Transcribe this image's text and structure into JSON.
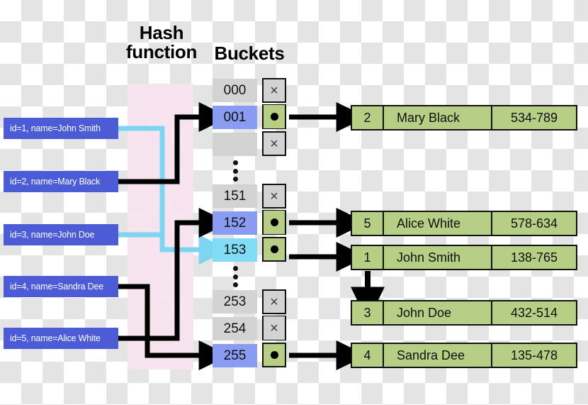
{
  "headings": {
    "hash_function": "Hash\nfunction",
    "buckets": "Buckets"
  },
  "colors": {
    "input_box": "#4c5cd6",
    "bucket_highlight_blue": "#8a9bf2",
    "bucket_highlight_cyan": "#7fdcf4",
    "bucket_default": "#d3d3d3",
    "record_green": "#b6cf85",
    "hash_band_pink": "#f7e3ee",
    "wire_black": "#000000",
    "wire_cyan": "#7fd4f2"
  },
  "inputs": [
    {
      "label": "id=1, name=John Smith",
      "id": "1",
      "name": "John Smith"
    },
    {
      "label": "id=2, name=Mary Black",
      "id": "2",
      "name": "Mary Black"
    },
    {
      "label": "id=3, name=John Doe",
      "id": "3",
      "name": "John Doe"
    },
    {
      "label": "id=4, name=Sandra Dee",
      "id": "4",
      "name": "Sandra Dee"
    },
    {
      "label": "id=5, name=Alice White",
      "id": "5",
      "name": "Alice White"
    }
  ],
  "buckets": [
    {
      "index": "000",
      "flag": "×",
      "occupied": false,
      "highlight": "none"
    },
    {
      "index": "001",
      "flag": "dot",
      "occupied": true,
      "highlight": "blue"
    },
    {
      "index": "",
      "flag": "×",
      "occupied": false,
      "highlight": "none"
    },
    {
      "index": "151",
      "flag": "×",
      "occupied": false,
      "highlight": "none"
    },
    {
      "index": "152",
      "flag": "dot",
      "occupied": true,
      "highlight": "blue"
    },
    {
      "index": "153",
      "flag": "dot",
      "occupied": true,
      "highlight": "cyan"
    },
    {
      "index": "253",
      "flag": "×",
      "occupied": false,
      "highlight": "none"
    },
    {
      "index": "254",
      "flag": "×",
      "occupied": false,
      "highlight": "none"
    },
    {
      "index": "255",
      "flag": "dot",
      "occupied": true,
      "highlight": "blue"
    }
  ],
  "records": [
    {
      "id": "2",
      "name": "Mary Black",
      "phone": "534-789"
    },
    {
      "id": "5",
      "name": "Alice White",
      "phone": "578-634"
    },
    {
      "id": "1",
      "name": "John Smith",
      "phone": "138-765"
    },
    {
      "id": "3",
      "name": "John Doe",
      "phone": "432-514"
    },
    {
      "id": "4",
      "name": "Sandra Dee",
      "phone": "135-478"
    }
  ],
  "icons": {
    "empty_slot": "cross-icon",
    "filled_slot": "dot-icon",
    "chain_arrow": "arrow-down-icon",
    "link_arrow": "arrow-right-icon",
    "continuation": "vertical-ellipsis-icon"
  }
}
